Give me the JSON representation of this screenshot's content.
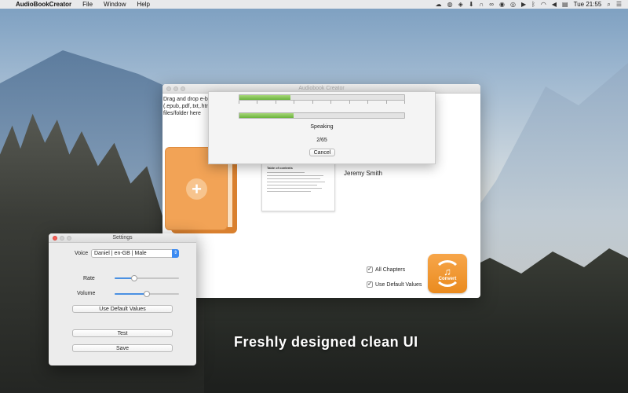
{
  "menubar": {
    "app_name": "AudioBookCreator",
    "items": [
      "File",
      "Window",
      "Help"
    ],
    "clock": "Tue 21:55"
  },
  "main_window": {
    "title": "Audiobook Creator",
    "drop_text": "Drag and drop e-book (.epub,.pdf,.txt,.htm,.html) files/folder here",
    "document_title": "Table of contents",
    "author": "Jeremy Smith",
    "options": {
      "all_chapters": {
        "label": "All Chapters",
        "checked": true
      },
      "use_default_values": {
        "label": "Use Default Values",
        "checked": true
      }
    },
    "convert_label": "Convert"
  },
  "progress_sheet": {
    "overall_progress": 0.31,
    "chapter_progress": 0.33,
    "status": "Speaking",
    "counter": "2/65",
    "cancel_label": "Cancel"
  },
  "settings": {
    "title": "Settings",
    "voice_label": "Voice",
    "voice_value": "Daniel | en-GB | Male",
    "rate_label": "Rate",
    "rate_value": 0.3,
    "volume_label": "Volume",
    "volume_value": 0.5,
    "default_values_label": "Use Default Values",
    "test_label": "Test",
    "save_label": "Save"
  },
  "tagline": "Freshly designed clean UI",
  "colors": {
    "accent_orange": "#f2a356",
    "progress_green": "#6ab43c",
    "select_blue": "#3c8bf2"
  }
}
